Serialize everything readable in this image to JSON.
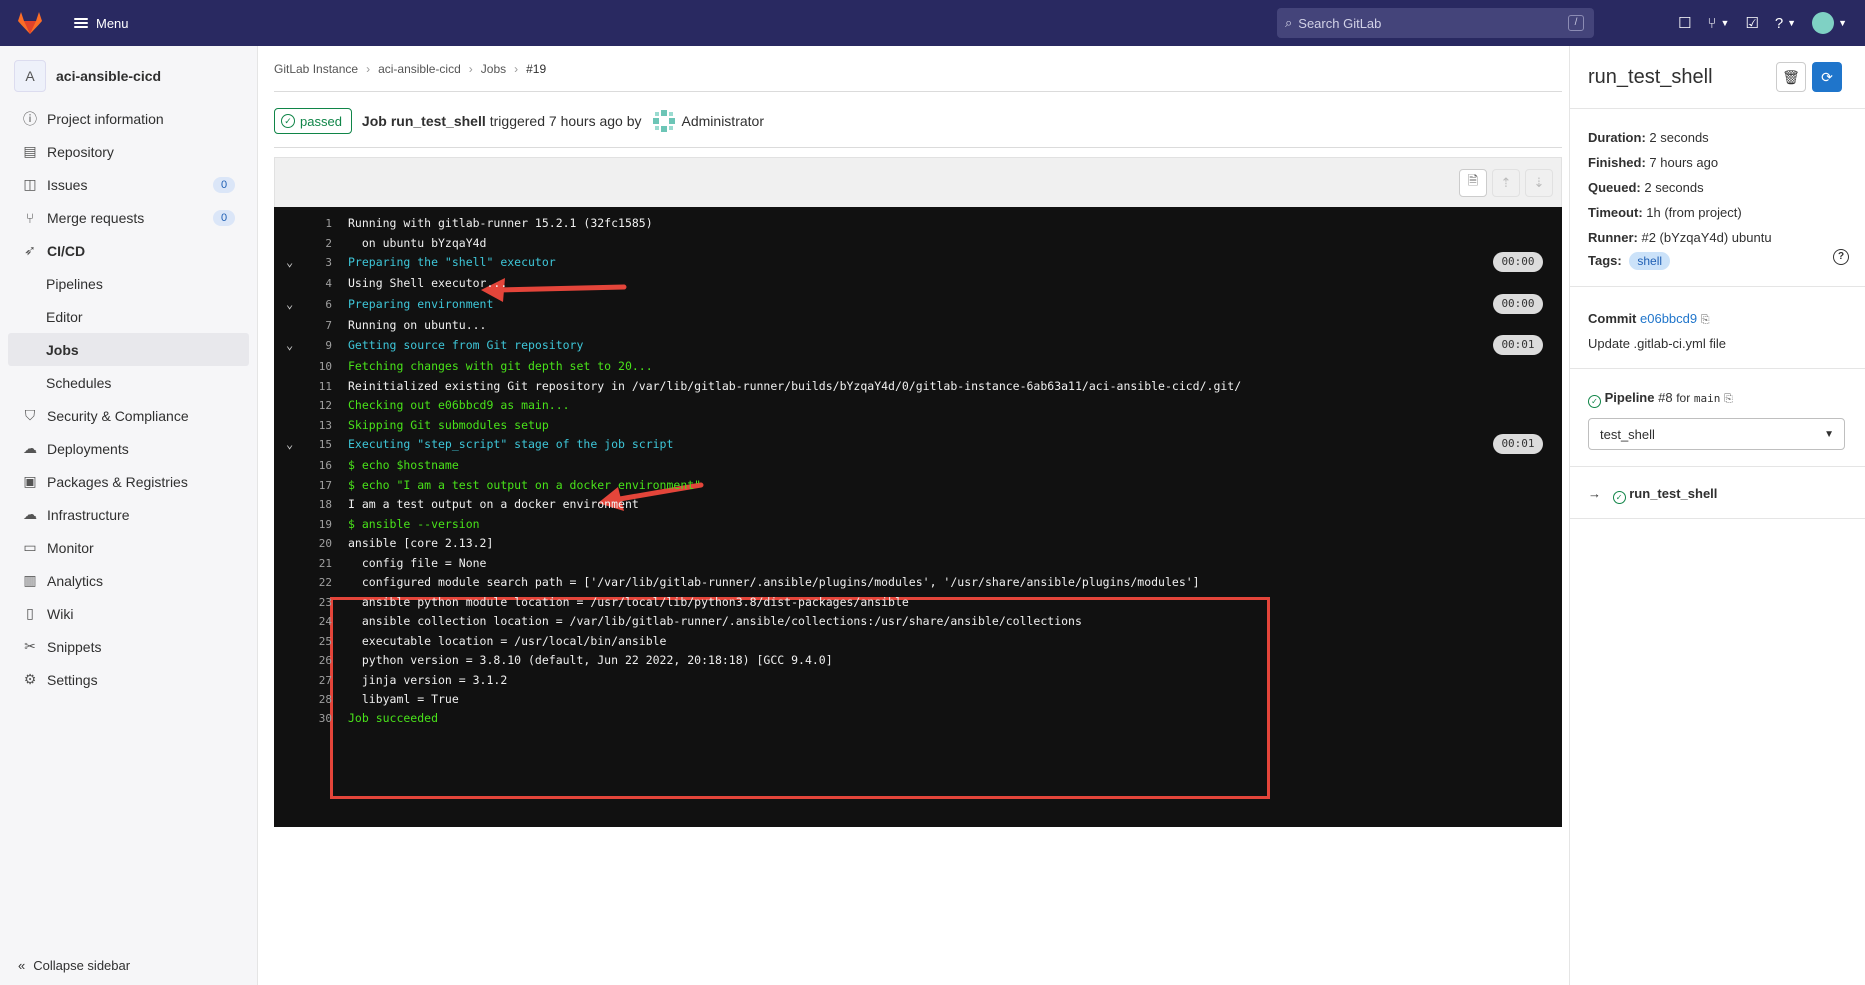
{
  "topbar": {
    "menu_label": "Menu",
    "search_placeholder": "Search GitLab",
    "search_shortcut": "/"
  },
  "sidebar": {
    "project_initial": "A",
    "project_name": "aci-ansible-cicd",
    "items": [
      {
        "label": "Project information",
        "icon": "info-icon"
      },
      {
        "label": "Repository",
        "icon": "book-icon"
      },
      {
        "label": "Issues",
        "icon": "issues-icon",
        "badge": "0"
      },
      {
        "label": "Merge requests",
        "icon": "merge-request-icon",
        "badge": "0"
      },
      {
        "label": "CI/CD",
        "icon": "rocket-icon"
      },
      {
        "label": "Pipelines"
      },
      {
        "label": "Editor"
      },
      {
        "label": "Jobs"
      },
      {
        "label": "Schedules"
      },
      {
        "label": "Security & Compliance",
        "icon": "shield-icon"
      },
      {
        "label": "Deployments",
        "icon": "deployments-icon"
      },
      {
        "label": "Packages & Registries",
        "icon": "package-icon"
      },
      {
        "label": "Infrastructure",
        "icon": "cloud-icon"
      },
      {
        "label": "Monitor",
        "icon": "monitor-icon"
      },
      {
        "label": "Analytics",
        "icon": "chart-icon"
      },
      {
        "label": "Wiki",
        "icon": "wiki-icon"
      },
      {
        "label": "Snippets",
        "icon": "snippet-icon"
      },
      {
        "label": "Settings",
        "icon": "gear-icon"
      }
    ],
    "collapse_label": "Collapse sidebar"
  },
  "breadcrumb": [
    "GitLab Instance",
    "aci-ansible-cicd",
    "Jobs",
    "#19"
  ],
  "job_header": {
    "status": "passed",
    "job_word": "Job",
    "job_name": "run_test_shell",
    "triggered_text": "triggered 7 hours ago by",
    "user": "Administrator"
  },
  "log": {
    "lines": [
      {
        "n": "1",
        "text": "Running with gitlab-runner 15.2.1 (32fc1585)"
      },
      {
        "n": "2",
        "text": "  on ubuntu bYzqaY4d"
      },
      {
        "n": "3",
        "text": "Preparing the \"shell\" executor",
        "dur": "00:00"
      },
      {
        "n": "4",
        "text": "Using Shell executor..."
      },
      {
        "n": "6",
        "text": "Preparing environment",
        "dur": "00:00"
      },
      {
        "n": "7",
        "text": "Running on ubuntu..."
      },
      {
        "n": "9",
        "text": "Getting source from Git repository",
        "dur": "00:01"
      },
      {
        "n": "10",
        "text": "Fetching changes with git depth set to 20..."
      },
      {
        "n": "11",
        "text": "Reinitialized existing Git repository in /var/lib/gitlab-runner/builds/bYzqaY4d/0/gitlab-instance-6ab63a11/aci-ansible-cicd/.git/"
      },
      {
        "n": "12",
        "text": "Checking out e06bbcd9 as main..."
      },
      {
        "n": "13",
        "text": "Skipping Git submodules setup"
      },
      {
        "n": "15",
        "text": "Executing \"step_script\" stage of the job script",
        "dur": "00:01"
      },
      {
        "n": "16",
        "text": "$ echo $hostname"
      },
      {
        "n": "17",
        "text": "$ echo \"I am a test output on a docker environment\""
      },
      {
        "n": "18",
        "text": "I am a test output on a docker environment"
      },
      {
        "n": "19",
        "text": "$ ansible --version"
      },
      {
        "n": "20",
        "text": "ansible [core 2.13.2]"
      },
      {
        "n": "21",
        "text": "  config file = None"
      },
      {
        "n": "22",
        "text": "  configured module search path = ['/var/lib/gitlab-runner/.ansible/plugins/modules', '/usr/share/ansible/plugins/modules']"
      },
      {
        "n": "23",
        "text": "  ansible python module location = /usr/local/lib/python3.8/dist-packages/ansible"
      },
      {
        "n": "24",
        "text": "  ansible collection location = /var/lib/gitlab-runner/.ansible/collections:/usr/share/ansible/collections"
      },
      {
        "n": "25",
        "text": "  executable location = /usr/local/bin/ansible"
      },
      {
        "n": "26",
        "text": "  python version = 3.8.10 (default, Jun 22 2022, 20:18:18) [GCC 9.4.0]"
      },
      {
        "n": "27",
        "text": "  jinja version = 3.1.2"
      },
      {
        "n": "28",
        "text": "  libyaml = True"
      },
      {
        "n": "30",
        "text": "Job succeeded"
      }
    ]
  },
  "right": {
    "title": "run_test_shell",
    "duration_label": "Duration:",
    "duration": "2 seconds",
    "finished_label": "Finished:",
    "finished": "7 hours ago",
    "queued_label": "Queued:",
    "queued": "2 seconds",
    "timeout_label": "Timeout:",
    "timeout": "1h (from project)",
    "runner_label": "Runner:",
    "runner": "#2 (bYzqaY4d) ubuntu",
    "tags_label": "Tags:",
    "tag": "shell",
    "commit_label": "Commit",
    "commit_sha": "e06bbcd9",
    "commit_msg": "Update .gitlab-ci.yml file",
    "pipeline_label": "Pipeline",
    "pipeline_id": "#8",
    "pipeline_for": "for",
    "pipeline_ref": "main",
    "stage_select": "test_shell",
    "job_link": "run_test_shell"
  },
  "colors": {
    "topbar": "#292961",
    "success": "#108548",
    "accent": "#1f75cb",
    "annotation": "#e4453a"
  }
}
